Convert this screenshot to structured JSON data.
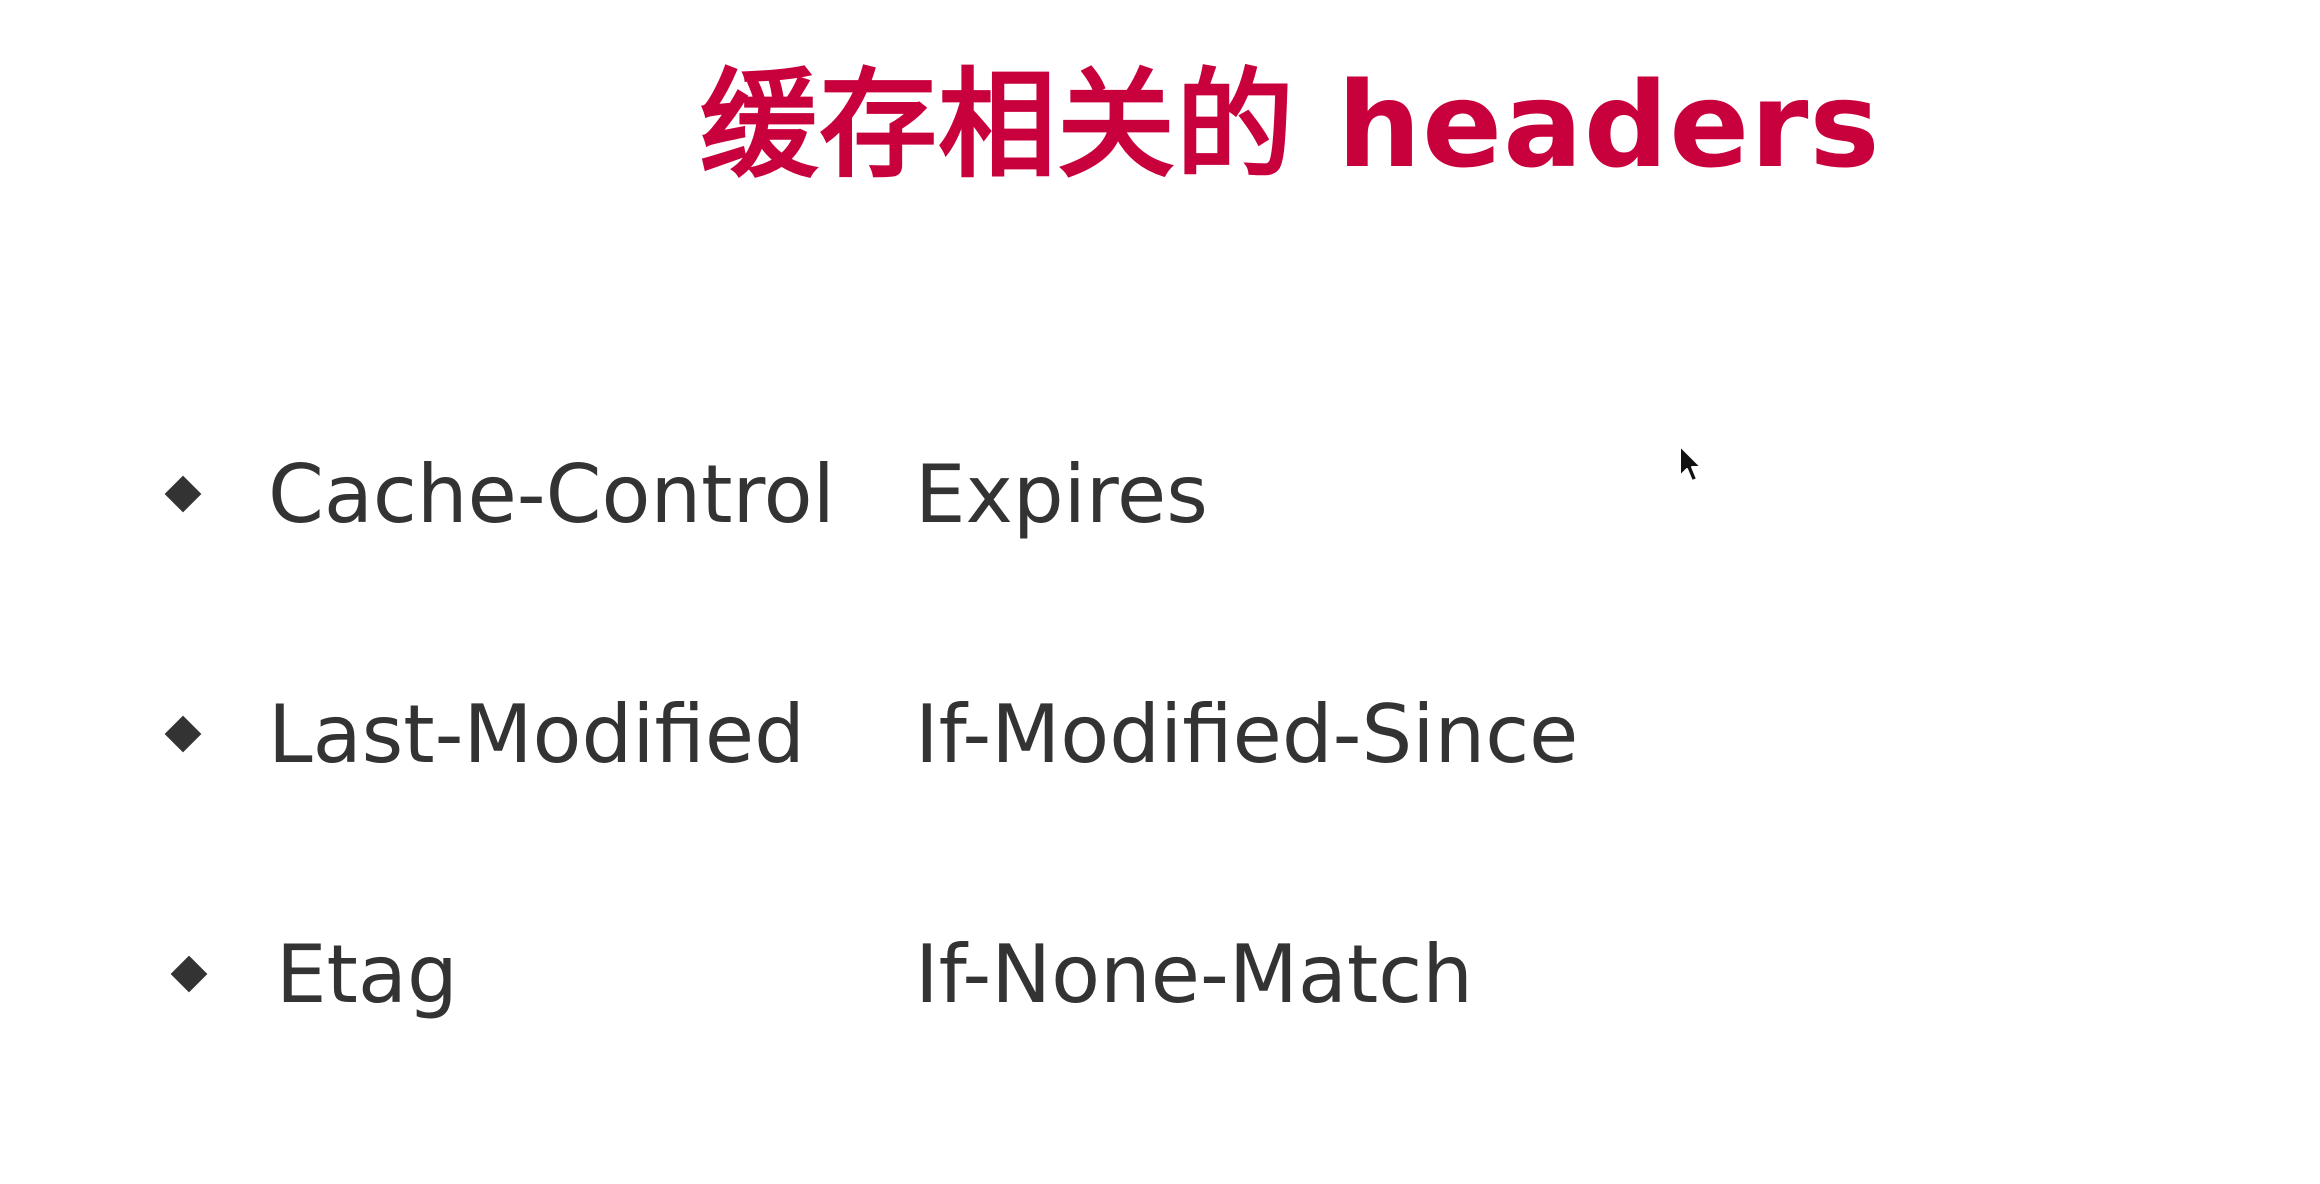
{
  "slide": {
    "title": "缓存相关的 headers",
    "rows": [
      {
        "left": "Cache-Control",
        "right": "Expires"
      },
      {
        "left": "Last-Modified",
        "right": "If-Modified-Since"
      },
      {
        "left": "Etag",
        "right": "If-None-Match"
      }
    ]
  },
  "colors": {
    "title": "#c8003c",
    "text": "#333333",
    "background": "#ffffff"
  },
  "icons": {
    "bullet": "diamond-bullet-icon",
    "cursor": "mouse-pointer-icon"
  }
}
